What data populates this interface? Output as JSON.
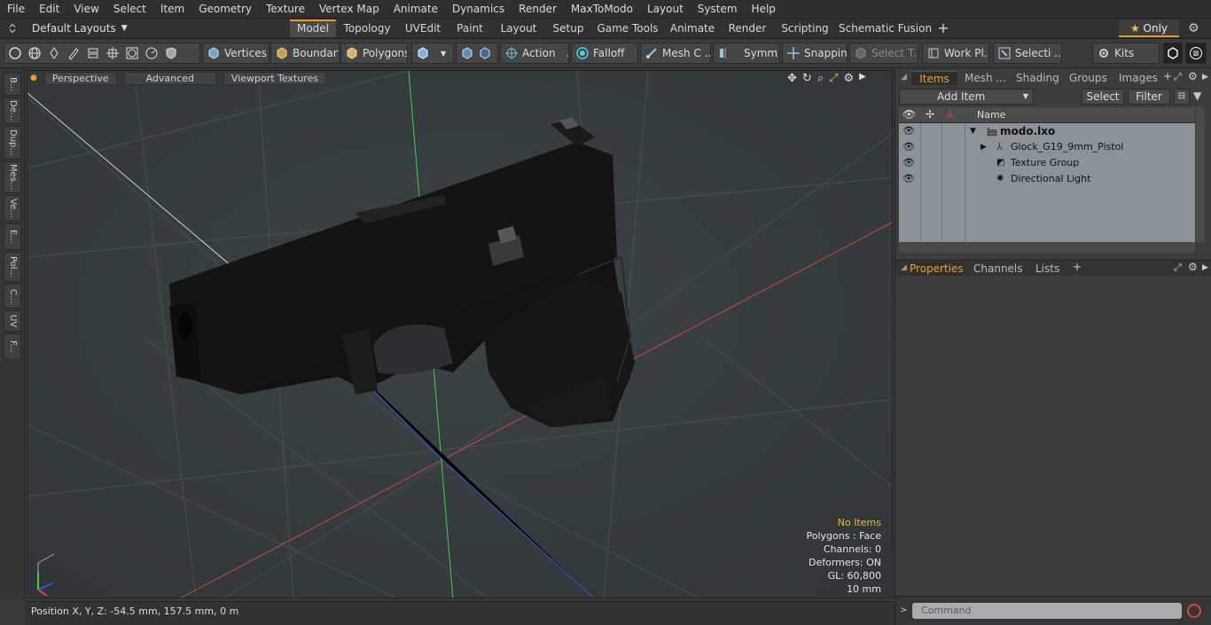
{
  "menu": [
    "File",
    "Edit",
    "View",
    "Select",
    "Item",
    "Geometry",
    "Texture",
    "Vertex Map",
    "Animate",
    "Dynamics",
    "Render",
    "MaxToModo",
    "Layout",
    "System",
    "Help"
  ],
  "layouts_label": "Default Layouts",
  "tabs": [
    "Model",
    "Topology",
    "UVEdit",
    "Paint",
    "Layout",
    "Setup",
    "Game Tools",
    "Animate",
    "Render",
    "Scripting",
    "Schematic Fusion"
  ],
  "only_label": "Only",
  "toolbar": {
    "vertices": "Vertices",
    "boundary": "Boundary",
    "polygons": "Polygons",
    "action": "Action",
    "falloff": "Falloff",
    "mesh": "Mesh C ...",
    "symm": "Symm ...",
    "snapping": "Snapping",
    "select_t": "Select T...",
    "work_pl": "Work Pl...",
    "selecti": "Selecti ...",
    "kits": "Kits"
  },
  "left_tabs": [
    "B...",
    "De...",
    "Dup...",
    "Mes...",
    "Ve...",
    "E...",
    "Pol...",
    "C...",
    "UV",
    "F..."
  ],
  "viewport": {
    "perspective": "Perspective",
    "advanced": "Advanced",
    "textures": "Viewport Textures",
    "stats": {
      "items": "No Items",
      "polygons": "Polygons : Face",
      "channels": "Channels: 0",
      "deformers": "Deformers: ON",
      "gl": "GL: 60,800",
      "unit": "10 mm"
    }
  },
  "status": {
    "position": "Position X, Y, Z:   -54.5 mm, 157.5 mm, 0 m"
  },
  "right": {
    "tabs": [
      "Items",
      "Mesh ...",
      "Shading",
      "Groups",
      "Images"
    ],
    "add_item": "Add Item",
    "select": "Select",
    "filter": "Filter",
    "col_name": "Name",
    "items": [
      {
        "name": "modo.lxo"
      },
      {
        "name": "Glock_G19_9mm_Pistol"
      },
      {
        "name": "Texture Group"
      },
      {
        "name": "Directional Light"
      }
    ],
    "prop_tabs": [
      "Properties",
      "Channels",
      "Lists"
    ],
    "command_placeholder": "Command"
  },
  "colors": {
    "accent": "#e89a2a",
    "warn": "#f2b632",
    "axis_x": "#d8443c",
    "axis_y": "#3cd048",
    "axis_z": "#3c52d8"
  }
}
